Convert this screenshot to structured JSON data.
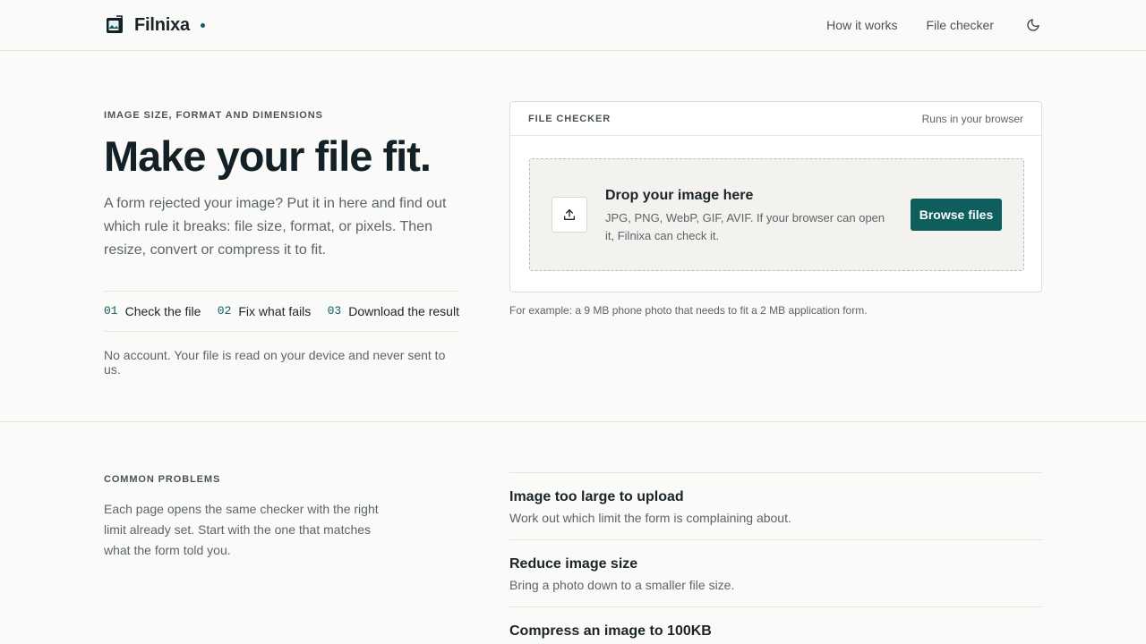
{
  "header": {
    "brand": "Filnixa",
    "nav": [
      {
        "label": "How it works"
      },
      {
        "label": "File checker"
      }
    ],
    "theme_icon": "moon-icon"
  },
  "hero": {
    "eyebrow": "IMAGE SIZE, FORMAT AND DIMENSIONS",
    "headline": "Make your file fit.",
    "lead": "A form rejected your image? Put it in here and find out which rule it breaks: file size, format, or pixels. Then resize, convert or compress it to fit.",
    "steps": [
      {
        "num": "01",
        "label": "Check the file"
      },
      {
        "num": "02",
        "label": "Fix what fails"
      },
      {
        "num": "03",
        "label": "Download the result"
      }
    ],
    "note": "No account. Your file is read on your device and never sent to us."
  },
  "checker": {
    "title": "FILE CHECKER",
    "subtitle": "Runs in your browser",
    "drop_title": "Drop your image here",
    "drop_desc": "JPG, PNG, WebP, GIF, AVIF. If your browser can open it, Filnixa can check it.",
    "browse_label": "Browse files",
    "example": "For example: a 9 MB phone photo that needs to fit a 2 MB application form."
  },
  "problems": {
    "eyebrow": "COMMON PROBLEMS",
    "desc": "Each page opens the same checker with the right limit already set. Start with the one that matches what the form told you.",
    "items": [
      {
        "title": "Image too large to upload",
        "desc": "Work out which limit the form is complaining about."
      },
      {
        "title": "Reduce image size",
        "desc": "Bring a photo down to a smaller file size."
      },
      {
        "title": "Compress an image to 100KB",
        "desc": ""
      }
    ]
  },
  "colors": {
    "accent": "#0f5e5e",
    "background": "#fafaf8",
    "dropzone": "#f3f2ee"
  }
}
